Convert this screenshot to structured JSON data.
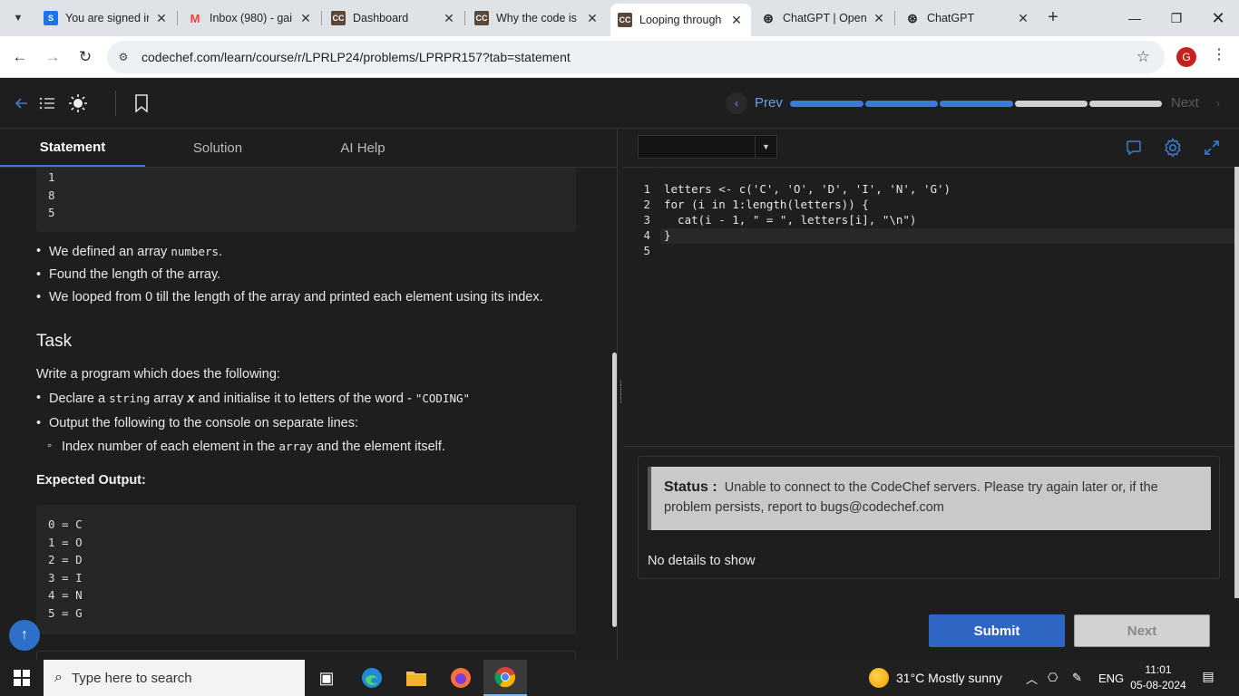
{
  "browser": {
    "tabs": [
      {
        "title": "You are signed in",
        "favicon": "S",
        "favicon_color": "#1a73e8"
      },
      {
        "title": "Inbox (980) - gai",
        "favicon": "M",
        "favicon_color": "#ea4335"
      },
      {
        "title": "Dashboard",
        "favicon": "CC",
        "favicon_color": "#5b4638"
      },
      {
        "title": "Why the code is",
        "favicon": "CC",
        "favicon_color": "#5b4638"
      },
      {
        "title": "Looping through",
        "favicon": "CC",
        "favicon_color": "#5b4638"
      },
      {
        "title": "ChatGPT | OpenA",
        "favicon": "⊛",
        "favicon_color": "#222222"
      },
      {
        "title": "ChatGPT",
        "favicon": "⊛",
        "favicon_color": "#222222"
      }
    ],
    "url": "codechef.com/learn/course/r/LPRLP24/problems/LPRPR157?tab=statement",
    "profile_initial": "G"
  },
  "appbar": {
    "prev_label": "Prev",
    "next_label": "Next",
    "progress_completed": 3,
    "progress_total": 5
  },
  "left_tabs": {
    "statement": "Statement",
    "solution": "Solution",
    "ai_help": "AI Help"
  },
  "statement": {
    "top_code_lines": [
      "1",
      "8",
      "5"
    ],
    "bullets": {
      "b1_pre": "We defined an array ",
      "b1_code": "numbers",
      "b1_post": ".",
      "b2": "Found the length of the array.",
      "b3": "We looped from 0 till the length of the array and printed each element using its index."
    },
    "task_heading": "Task",
    "task_intro": "Write a program which does the following:",
    "task_items": {
      "t1_a": "Declare a ",
      "t1_code1": "string",
      "t1_b": " array ",
      "t1_var": "x",
      "t1_c": " and initialise it to letters of the word - ",
      "t1_code2": "\"CODING\"",
      "t2": "Output the following to the console on separate lines:",
      "t3_a": "Index number of each element in the ",
      "t3_code": "array",
      "t3_b": " and the element itself."
    },
    "expected_heading": "Expected Output:",
    "expected_lines": [
      "0 = C",
      "1 = O",
      "2 = D",
      "3 = I",
      "4 = N",
      "5 = G"
    ]
  },
  "editor": {
    "language": "",
    "lines": [
      "letters <- c('C', 'O', 'D', 'I', 'N', 'G')",
      "for (i in 1:length(letters)) {",
      "  cat(i - 1, \" = \", letters[i], \"\\n\")",
      "}",
      ""
    ]
  },
  "output": {
    "status_label": "Status :",
    "status_text": "Unable to connect to the CodeChef servers. Please try again later or, if the problem persists, report to bugs@codechef.com",
    "no_details": "No details to show"
  },
  "actions": {
    "submit": "Submit",
    "next": "Next"
  },
  "taskbar": {
    "search_placeholder": "Type here to search",
    "weather": "31°C  Mostly sunny",
    "language": "ENG",
    "time": "11:01",
    "date": "05-08-2024"
  }
}
